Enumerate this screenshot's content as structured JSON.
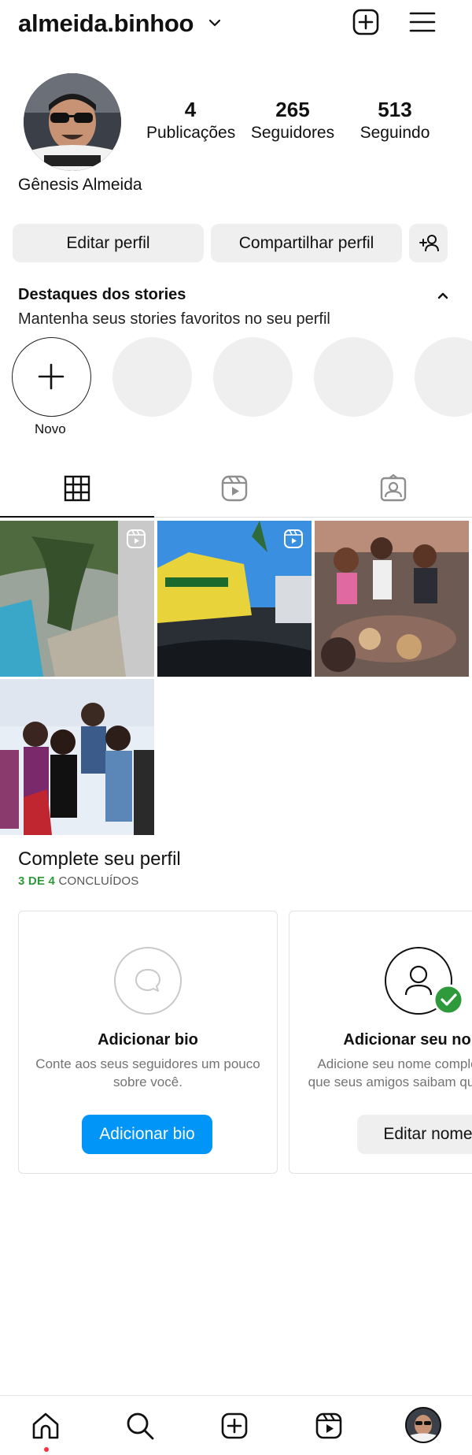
{
  "header": {
    "username": "almeida.binhoo",
    "icons": [
      "chevron-down-icon",
      "create-plus-icon",
      "menu-icon"
    ]
  },
  "profile": {
    "full_name": "Gênesis Almeida",
    "stats": [
      {
        "value": "4",
        "label": "Publicações"
      },
      {
        "value": "265",
        "label": "Seguidores"
      },
      {
        "value": "513",
        "label": "Seguindo"
      }
    ],
    "buttons": {
      "edit": "Editar perfil",
      "share": "Compartilhar perfil"
    }
  },
  "highlights": {
    "title": "Destaques dos stories",
    "subtitle": "Mantenha seus stories favoritos no seu perfil",
    "new_label": "Novo"
  },
  "tabs": [
    "grid-icon",
    "reels-icon",
    "tagged-icon"
  ],
  "complete_profile": {
    "title": "Complete seu perfil",
    "progress_done": "3 DE 4",
    "progress_rest": "CONCLUÍDOS",
    "cards": [
      {
        "title": "Adicionar bio",
        "description": "Conte aos seus seguidores um pouco sobre você.",
        "button": "Adicionar bio"
      },
      {
        "title": "Adicionar seu nome",
        "description": "Adicione seu nome completo para que seus amigos saibam que é você.",
        "button": "Editar nome"
      }
    ]
  },
  "colors": {
    "accent_blue": "#0095f6",
    "success_green": "#2e9a3c",
    "notification_red": "#ff3040",
    "button_gray": "#efefef"
  }
}
